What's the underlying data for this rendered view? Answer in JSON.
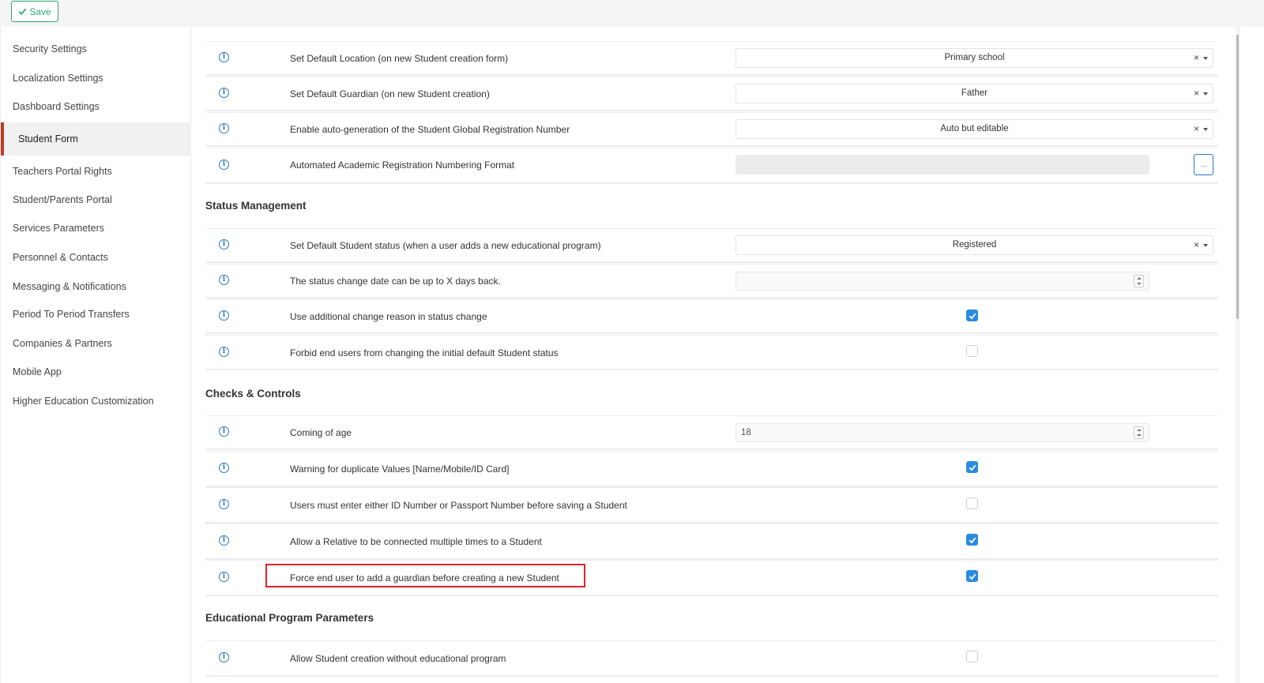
{
  "toolbar": {
    "save_label": "Save"
  },
  "sidebar": {
    "items": [
      {
        "label": "Security Settings"
      },
      {
        "label": "Localization Settings"
      },
      {
        "label": "Dashboard Settings"
      },
      {
        "label": "Student Form",
        "active": true
      },
      {
        "label": "Teachers Portal Rights"
      },
      {
        "label": "Student/Parents Portal"
      },
      {
        "label": "Services Parameters"
      },
      {
        "label": "Personnel & Contacts"
      },
      {
        "label": "Messaging & Notifications"
      },
      {
        "label": "Period To Period Transfers"
      },
      {
        "label": "Companies & Partners"
      },
      {
        "label": "Mobile App"
      },
      {
        "label": "Higher Education Customization"
      }
    ]
  },
  "general": {
    "default_location": {
      "label": "Set Default Location (on new Student creation form)",
      "value": "Primary school",
      "clear": "×"
    },
    "default_guardian": {
      "label": "Set Default Guardian (on new Student creation)",
      "value": "Father",
      "clear": "×"
    },
    "auto_generation": {
      "label": "Enable auto-generation of the Student Global Registration Number",
      "value": "Auto but editable",
      "clear": "×"
    },
    "numbering_format": {
      "label": "Automated Academic Registration Numbering Format",
      "button": "..."
    }
  },
  "status_management": {
    "title": "Status Management",
    "default_status": {
      "label": "Set Default Student status (when a user adds a new educational program)",
      "value": "Registered",
      "clear": "×"
    },
    "days_back": {
      "label": "The status change date can be up to X days back.",
      "value": ""
    },
    "change_reason": {
      "label": "Use additional change reason in status change",
      "checked": true
    },
    "forbid_change": {
      "label": "Forbid end users from changing the initial default Student status",
      "checked": false
    }
  },
  "checks_controls": {
    "title": "Checks & Controls",
    "coming_of_age": {
      "label": "Coming of age",
      "value": "18"
    },
    "duplicate_warning": {
      "label": "Warning for duplicate Values [Name/Mobile/ID Card]",
      "checked": true
    },
    "id_required": {
      "label": "Users must enter either ID Number or Passport Number before saving a Student",
      "checked": false
    },
    "relative_multiple": {
      "label": "Allow a Relative to be connected multiple times to a Student",
      "checked": true
    },
    "force_guardian": {
      "label": "Force end user to add a guardian before creating a new Student",
      "checked": true
    }
  },
  "educational_program": {
    "title": "Educational Program Parameters",
    "without_program": {
      "label": "Allow Student creation without educational program",
      "checked": false
    }
  },
  "colors": {
    "accent_blue": "#2a8be0",
    "save_green": "#2eaa6c",
    "active_red": "#c0392b",
    "highlight_red": "#e0202a"
  }
}
